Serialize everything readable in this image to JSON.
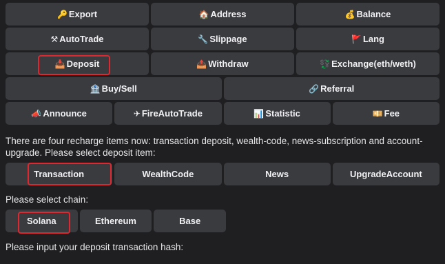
{
  "menu": {
    "row1": [
      {
        "icon": "🔑",
        "icon_name": "key-icon",
        "label": "Export"
      },
      {
        "icon": "🏠",
        "icon_name": "house-icon",
        "label": "Address"
      },
      {
        "icon": "💰",
        "icon_name": "money-bag-icon",
        "label": "Balance"
      }
    ],
    "row2": [
      {
        "icon": "⚒",
        "icon_name": "hammer-pick-icon",
        "label": "AutoTrade"
      },
      {
        "icon": "🔧",
        "icon_name": "wrench-icon",
        "label": "Slippage"
      },
      {
        "icon": "🚩",
        "icon_name": "flag-icon",
        "label": "Lang"
      }
    ],
    "row3": [
      {
        "icon": "📥",
        "icon_name": "inbox-tray-icon",
        "label": "Deposit"
      },
      {
        "icon": "📤",
        "icon_name": "outbox-tray-icon",
        "label": "Withdraw"
      },
      {
        "icon": "💱",
        "icon_name": "exchange-icon",
        "label": "Exchange(eth/weth)"
      }
    ],
    "row4": [
      {
        "icon": "🏦",
        "icon_name": "bank-icon",
        "label": "Buy/Sell"
      },
      {
        "icon": "🔗",
        "icon_name": "link-icon",
        "label": "Referral"
      }
    ],
    "row5": [
      {
        "icon": "📣",
        "icon_name": "megaphone-icon",
        "label": "Announce"
      },
      {
        "icon": "✈",
        "icon_name": "airplane-icon",
        "label": "FireAutoTrade"
      },
      {
        "icon": "📊",
        "icon_name": "bar-chart-icon",
        "label": "Statistic"
      },
      {
        "icon": "💴",
        "icon_name": "banknote-icon",
        "label": "Fee"
      }
    ]
  },
  "messages": {
    "deposit_intro": "There are four recharge items now: transaction deposit, wealth-code, news-subscription and account-upgrade. Please select deposit item:",
    "select_chain": "Please select chain:",
    "input_hash": "Please input your deposit transaction hash:"
  },
  "deposit_items": [
    "Transaction",
    "WealthCode",
    "News",
    "UpgradeAccount"
  ],
  "chains": [
    "Solana",
    "Ethereum",
    "Base"
  ],
  "colors": {
    "background": "#1f1f21",
    "button": "#3a3b3f",
    "highlight": "#e0262e"
  }
}
